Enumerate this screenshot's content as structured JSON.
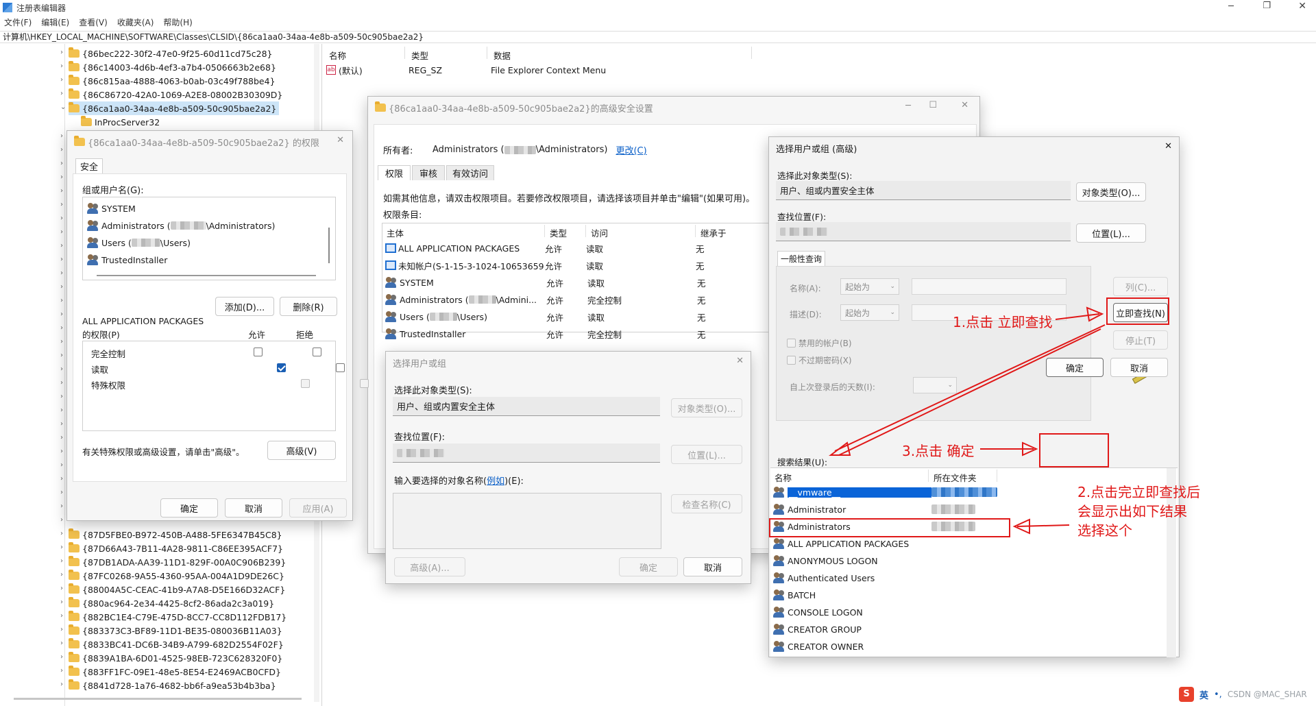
{
  "app": {
    "title": "注册表编辑器"
  },
  "menu": [
    "文件(F)",
    "编辑(E)",
    "查看(V)",
    "收藏夹(A)",
    "帮助(H)"
  ],
  "address": "计算机\\HKEY_LOCAL_MACHINE\\SOFTWARE\\Classes\\CLSID\\{86ca1aa0-34aa-4e8b-a509-50c905bae2a2}",
  "tree": {
    "top": [
      "{86bec222-30f2-47e0-9f25-60d11cd75c28}",
      "{86c14003-4d6b-4ef3-a7b4-0506663b2e68}",
      "{86c815aa-4888-4063-b0ab-03c49f788be4}",
      "{86C86720-42A0-1069-A2E8-08002B30309D}",
      "{86ca1aa0-34aa-4e8b-a509-50c905bae2a2}"
    ],
    "child": "InProcServer32",
    "bottom": [
      "{87D5FBE0-B972-450B-A488-5FE6347B45C8}",
      "{87D66A43-7B11-4A28-9811-C86EE395ACF7}",
      "{87DB1ADA-AA39-11D1-829F-00A0C906B239}",
      "{87FC0268-9A55-4360-95AA-004A1D9DE26C}",
      "{88004A5C-CEAC-41b9-A7A8-D5E166D32ACF}",
      "{880ac964-2e34-4425-8cf2-86ada2c3a019}",
      "{882BC1E4-C79E-475D-8CC7-CC8D112FDB17}",
      "{883373C3-BF89-11D1-BE35-080036B11A03}",
      "{8833BC41-DC6B-34B9-A799-682D2554F02F}",
      "{8839A1BA-6D01-4525-98EB-723C628320F0}",
      "{883FF1FC-09E1-48e5-8E54-E2469ACB0CFD}",
      "{8841d728-1a76-4682-bb6f-a9ea53b4b3ba}"
    ]
  },
  "values": {
    "headers": [
      "名称",
      "类型",
      "数据"
    ],
    "rows": [
      {
        "name": "(默认)",
        "type": "REG_SZ",
        "data": "File Explorer Context Menu"
      }
    ]
  },
  "perm": {
    "title": "{86ca1aa0-34aa-4e8b-a509-50c905bae2a2} 的权限",
    "tab": "安全",
    "group_label": "组或用户名(G):",
    "users": [
      {
        "pre": "SYSTEM",
        "post": ""
      },
      {
        "pre": "Administrators (",
        "post": "\\Administrators)"
      },
      {
        "pre": "Users (",
        "post": "\\Users)"
      },
      {
        "pre": "TrustedInstaller",
        "post": ""
      }
    ],
    "add": "添加(D)...",
    "remove": "删除(R)",
    "perm_for": "ALL APPLICATION PACKAGES",
    "perm_for2": "的权限(P)",
    "allow": "允许",
    "deny": "拒绝",
    "perms": [
      "完全控制",
      "读取",
      "特殊权限"
    ],
    "note": "有关特殊权限或高级设置，请单击\"高级\"。",
    "advanced": "高级(V)",
    "ok": "确定",
    "cancel": "取消",
    "apply": "应用(A)"
  },
  "adv": {
    "title": "{86ca1aa0-34aa-4e8b-a509-50c905bae2a2}的高级安全设置",
    "owner_label": "所有者:",
    "owner_pre": "Administrators (",
    "owner_post": "\\Administrators)",
    "change": "更改(C)",
    "tabs": [
      "权限",
      "审核",
      "有效访问"
    ],
    "info": "如需其他信息，请双击权限项目。若要修改权限项目，请选择该项目并单击\"编辑\"(如果可用)。",
    "entries_label": "权限条目:",
    "headers": [
      "主体",
      "类型",
      "访问",
      "继承于"
    ],
    "rows": [
      {
        "p1": "ALL APPLICATION PACKAGES",
        "p2": "",
        "t": "允许",
        "a": "读取",
        "i": "无"
      },
      {
        "p1": "未知帐户(S-1-15-3-1024-10653659...",
        "p2": "",
        "t": "允许",
        "a": "读取",
        "i": "无"
      },
      {
        "p1": "SYSTEM",
        "p2": "",
        "t": "允许",
        "a": "读取",
        "i": "无"
      },
      {
        "p1": "Administrators (",
        "p2": "\\Admini...",
        "t": "允许",
        "a": "完全控制",
        "i": "无"
      },
      {
        "p1": "Users (",
        "p2": "\\Users)",
        "t": "允许",
        "a": "读取",
        "i": "无"
      },
      {
        "p1": "TrustedInstaller",
        "p2": "",
        "t": "允许",
        "a": "完全控制",
        "i": "无"
      }
    ]
  },
  "sel_small": {
    "title": "选择用户或组",
    "type_label": "选择此对象类型(S):",
    "type_value": "用户、组或内置安全主体",
    "type_btn": "对象类型(O)...",
    "loc_label": "查找位置(F):",
    "loc_btn": "位置(L)...",
    "name_label_pre": "输入要选择的对象名称(",
    "name_label_link": "例如",
    "name_label_post": ")(E):",
    "check_btn": "检查名称(C)",
    "advanced": "高级(A)...",
    "ok": "确定",
    "cancel": "取消"
  },
  "sel_adv": {
    "title": "选择用户或组 (高级)",
    "type_label": "选择此对象类型(S):",
    "type_value": "用户、组或内置安全主体",
    "type_btn": "对象类型(O)...",
    "loc_label": "查找位置(F):",
    "loc_btn": "位置(L)...",
    "query_tab": "一般性查询",
    "name_label": "名称(A):",
    "desc_label": "描述(D):",
    "starts_with": "起始为",
    "columns_btn": "列(C)...",
    "find_btn": "立即查找(N)",
    "stop_btn": "停止(T)",
    "disabled_accounts": "禁用的帐户(B)",
    "nonexpiring": "不过期密码(X)",
    "days_label": "自上次登录后的天数(I):",
    "ok": "确定",
    "cancel": "取消",
    "results_label": "搜索结果(U):",
    "results_headers": [
      "名称",
      "所在文件夹"
    ],
    "results": [
      "__vmware__",
      "Administrator",
      "Administrators",
      "ALL APPLICATION PACKAGES",
      "ANONYMOUS LOGON",
      "Authenticated Users",
      "BATCH",
      "CONSOLE LOGON",
      "CREATOR GROUP",
      "CREATOR OWNER"
    ]
  },
  "annotations": {
    "step1": "1.点击 立即查找",
    "step2_l1": "2.点击完立即查找后",
    "step2_l2": "会显示出如下结果",
    "step2_l3": "选择这个",
    "step3": "3.点击 确定"
  },
  "tray": {
    "ime": "英",
    "watermark": "CSDN @MAC_SHAR"
  },
  "colors": {
    "annotation": "#e01818",
    "selection": "#0a64d8",
    "link": "#0a5fc8"
  }
}
